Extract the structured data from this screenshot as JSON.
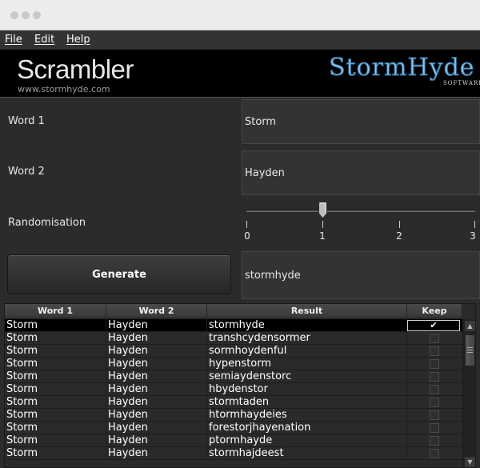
{
  "window": {
    "traffic_lights": [
      "close",
      "minimize",
      "zoom"
    ]
  },
  "menu": {
    "items": [
      "File",
      "Edit",
      "Help"
    ]
  },
  "banner": {
    "title": "Scrambler",
    "url": "www.stormhyde.com",
    "logo_text": "StormHyde",
    "logo_sub": "SOFTWARE"
  },
  "form": {
    "word1_label": "Word 1",
    "word1_value": "Storm",
    "word2_label": "Word 2",
    "word2_value": "Hayden",
    "randomisation_label": "Randomisation",
    "randomisation_value": 1,
    "randomisation_ticks": [
      "0",
      "1",
      "2",
      "3"
    ],
    "generate_label": "Generate",
    "result_value": "stormhyde"
  },
  "table": {
    "headers": [
      "Word 1",
      "Word 2",
      "Result",
      "Keep"
    ],
    "rows": [
      {
        "word1": "Storm",
        "word2": "Hayden",
        "result": "stormhyde",
        "keep": true,
        "keep_mark": "✔"
      },
      {
        "word1": "Storm",
        "word2": "Hayden",
        "result": "transhcydensormer",
        "keep": false
      },
      {
        "word1": "Storm",
        "word2": "Hayden",
        "result": "sormhoydenful",
        "keep": false
      },
      {
        "word1": "Storm",
        "word2": "Hayden",
        "result": "hypenstorm",
        "keep": false
      },
      {
        "word1": "Storm",
        "word2": "Hayden",
        "result": "semiaydenstorc",
        "keep": false
      },
      {
        "word1": "Storm",
        "word2": "Hayden",
        "result": "hbydenstor",
        "keep": false
      },
      {
        "word1": "Storm",
        "word2": "Hayden",
        "result": "stormtaden",
        "keep": false
      },
      {
        "word1": "Storm",
        "word2": "Hayden",
        "result": "htormhaydeies",
        "keep": false
      },
      {
        "word1": "Storm",
        "word2": "Hayden",
        "result": "forestorjhayenation",
        "keep": false
      },
      {
        "word1": "Storm",
        "word2": "Hayden",
        "result": "ptormhayde",
        "keep": false
      },
      {
        "word1": "Storm",
        "word2": "Hayden",
        "result": "stormhajdeest",
        "keep": false
      }
    ]
  },
  "colors": {
    "background": "#2b2b2b",
    "banner": "#000000",
    "logo": "#8fc3e8",
    "selected_row": "#000000"
  }
}
